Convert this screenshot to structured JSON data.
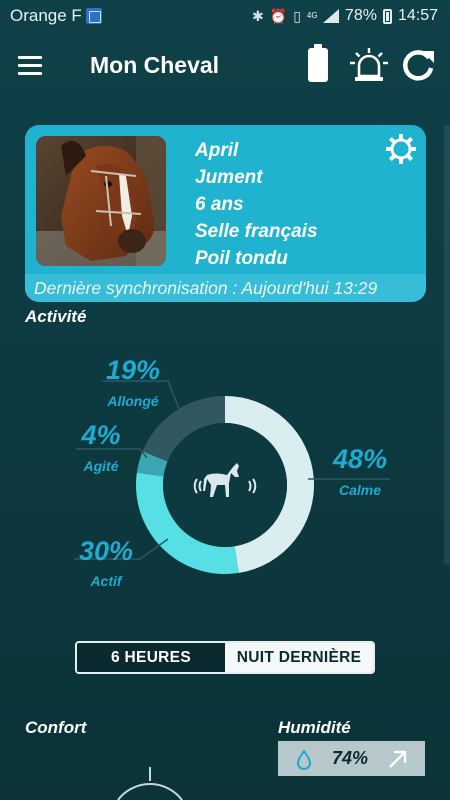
{
  "status_bar": {
    "carrier": "Orange F",
    "network": "4G",
    "battery": "78%",
    "time": "14:57"
  },
  "toolbar": {
    "title": "Mon Cheval",
    "icons": [
      "menu-icon",
      "battery-icon",
      "alarm-light-icon",
      "refresh-icon"
    ]
  },
  "horse": {
    "name": "April",
    "sex": "Jument",
    "age": "6 ans",
    "breed": "Selle français",
    "coat": "Poil tondu",
    "sync": "Dernière synchronisation : Aujourd'hui 13:29"
  },
  "activity": {
    "title": "Activité",
    "segments": [
      {
        "label": "Calme",
        "pct_text": "48%",
        "value": 48,
        "color": "#daeef2"
      },
      {
        "label": "Actif",
        "pct_text": "30%",
        "value": 30,
        "color": "#56e0e6"
      },
      {
        "label": "Agité",
        "pct_text": "4%",
        "value": 4,
        "color": "#3aa7b3"
      },
      {
        "label": "Allongé",
        "pct_text": "19%",
        "value": 19,
        "color": "#315761"
      }
    ]
  },
  "period": {
    "options": [
      "6 HEURES",
      "NUIT DERNIÈRE"
    ],
    "selected": "6 HEURES"
  },
  "confort": {
    "title": "Confort"
  },
  "humidity": {
    "title": "Humidité",
    "value": "74%"
  },
  "colors": {
    "accent": "#1fb3cf",
    "label_blue": "#1faad0",
    "background": "#0d3a3f"
  }
}
